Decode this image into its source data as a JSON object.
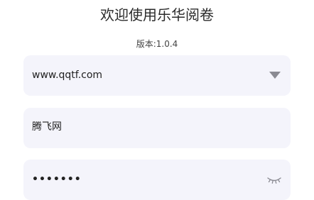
{
  "header": {
    "title": "欢迎使用乐华阅卷",
    "version": "版本:1.0.4"
  },
  "form": {
    "server": {
      "value": "www.qqtf.com",
      "icon": "dropdown-arrow-icon"
    },
    "username": {
      "value": "腾飞网"
    },
    "password": {
      "value": "•••••••",
      "icon": "eye-closed-icon"
    }
  },
  "colors": {
    "field_bg": "#f4f4fb",
    "icon_gray": "#8a8a92"
  }
}
